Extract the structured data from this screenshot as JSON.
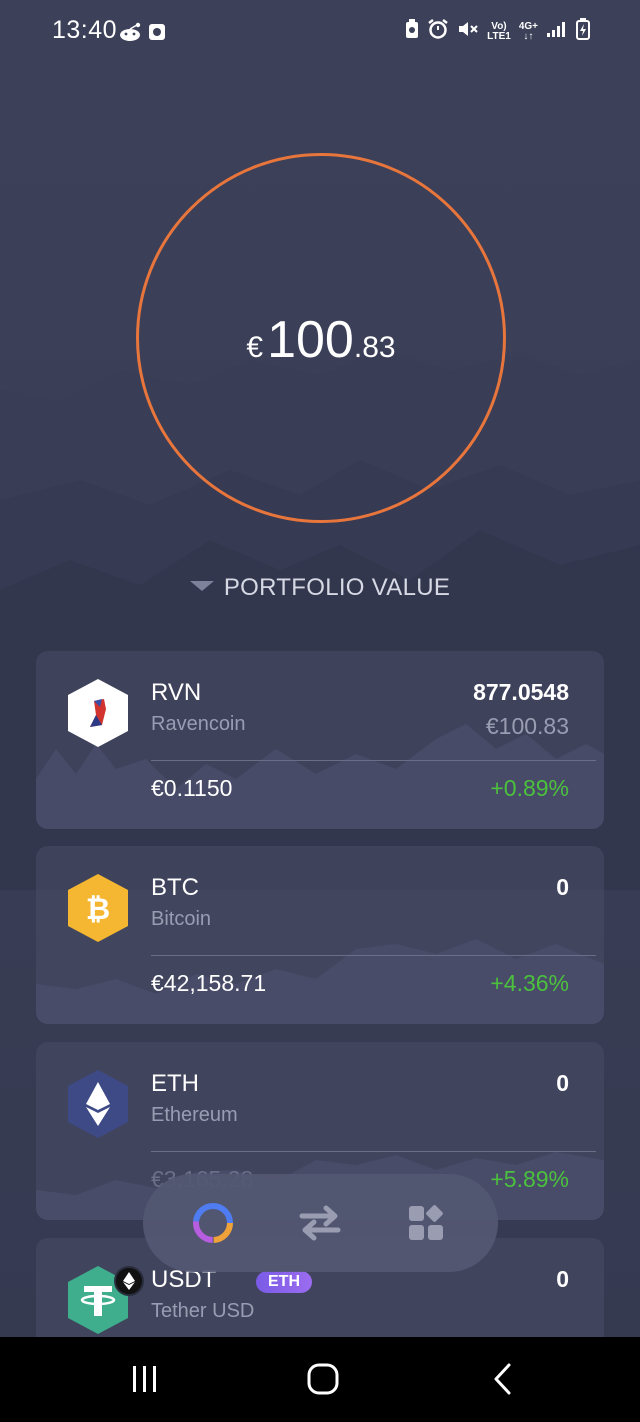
{
  "status_bar": {
    "time": "13:40",
    "network_top": "Vo)",
    "network_bottom": "LTE1",
    "network_gen": "4G+"
  },
  "portfolio": {
    "currency_symbol": "€",
    "value_main": "100",
    "value_decimal": ".83",
    "label": "PORTFOLIO VALUE",
    "ring_color": "#e8763c"
  },
  "assets": [
    {
      "symbol": "RVN",
      "name": "Ravencoin",
      "amount": "877.0548",
      "value": "€100.83",
      "price": "€0.1150",
      "change": "+0.89%",
      "icon": "ravencoin-icon",
      "icon_color": "#ffffff"
    },
    {
      "symbol": "BTC",
      "name": "Bitcoin",
      "amount": "0",
      "value": "",
      "price": "€42,158.71",
      "change": "+4.36%",
      "icon": "bitcoin-icon",
      "icon_color": "#f5b731"
    },
    {
      "symbol": "ETH",
      "name": "Ethereum",
      "amount": "0",
      "value": "",
      "price": "€3,165.28",
      "change": "+5.89%",
      "icon": "ethereum-icon",
      "icon_color": "#3e4a86"
    },
    {
      "symbol": "USDT",
      "name": "Tether USD",
      "amount": "0",
      "network": "ETH",
      "icon": "tether-icon",
      "icon_color": "#3fae8c"
    }
  ],
  "colors": {
    "positive_change": "#4bc13d",
    "accent": "#e8763c"
  },
  "bottom_nav": {
    "items": [
      "portfolio-icon",
      "exchange-icon",
      "apps-icon"
    ]
  }
}
